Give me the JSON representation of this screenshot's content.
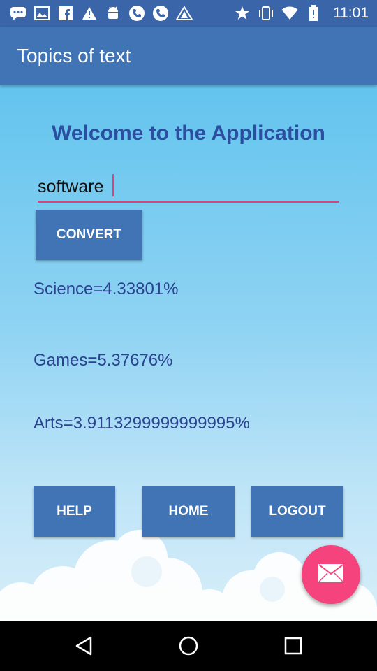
{
  "status_bar": {
    "time": "11:01",
    "left_icons": [
      "chat-icon",
      "image-icon",
      "facebook-icon",
      "warning-icon",
      "android-icon",
      "phone-icon",
      "phone-icon",
      "shape-icon"
    ],
    "right_icons": [
      "star-icon",
      "vibrate-icon",
      "wifi-icon",
      "battery-icon"
    ]
  },
  "app_bar": {
    "title": "Topics of text"
  },
  "main": {
    "welcome": "Welcome to the Application",
    "input_value": "software",
    "convert_label": "CONVERT",
    "results": [
      "Science=4.33801%",
      "Games=5.37676%",
      "Arts=3.9113299999999995%"
    ],
    "help_label": "HELP",
    "home_label": "HOME",
    "logout_label": "LOGOUT"
  },
  "colors": {
    "app_bar": "#4174b5",
    "status_bar": "#3a65a8",
    "accent": "#f4437d",
    "title_text": "#2b4ea0"
  }
}
